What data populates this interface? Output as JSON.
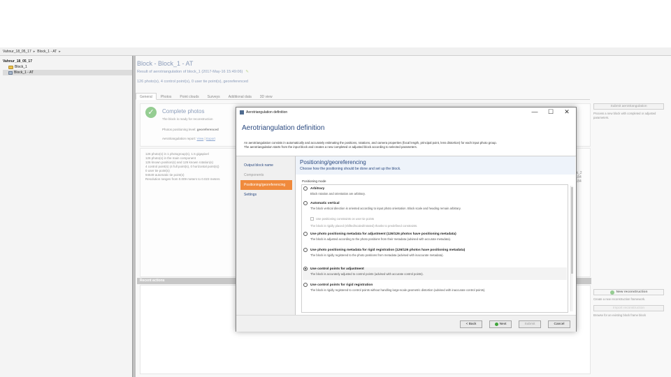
{
  "breadcrumb": {
    "items": [
      "Vahnur_18_05_17",
      "Block_1 - AT"
    ],
    "separator": "▸"
  },
  "tree": {
    "root": "Vahnur_18_05_17",
    "items": [
      "Block_1",
      "Block_1 - AT"
    ]
  },
  "block": {
    "title": "Block - Block_1 - AT",
    "result_line": "Result of aerotriangulation of block_1 (2017-May-16 15:49:06)",
    "counts_line": "126 photo(s), 4 control point(s), 0 user tie point(s), georeferenced"
  },
  "tabs": [
    "General",
    "Photos",
    "Point clouds",
    "Surveys",
    "Additional data",
    "3D view"
  ],
  "general": {
    "complete_title": "Complete photos",
    "complete_sub": "The block is ready for reconstruction",
    "pos_level_label": "Photos positioning level:",
    "pos_level_value": "georeferenced",
    "aero_report_label": "Aerotriangulation report:",
    "aero_report_link1": "View",
    "aero_report_sep": "|",
    "aero_report_link2": "Export"
  },
  "stats": [
    "126 photo(s) in 1 photogroup(s), 1.5 gigapixel",
    "126 photo(s) in the main component",
    "126 known position(s) and 126 known rotation(s)",
    "4 control point(s) (4 full point(s), 0 horizontal point(s))",
    "0 user tie point(s)",
    "94649 automatic tie point(s)",
    "Resolution ranges from 0.009 meters to 0.023 meters"
  ],
  "right_partial": [
    "ck_2",
    "8.84",
    "9.84"
  ],
  "side_panel": {
    "submit_aero_label": "Submit aerotriangulation",
    "submit_aero_desc": "Process a new block with completed or adjusted parameters.",
    "new_recon_label": "New reconstruction",
    "new_recon_desc": "Create a new reconstruction framework.",
    "import_recon_label": "Import reconstruction",
    "import_recon_desc": "Browse for an existing block frame block"
  },
  "recent": {
    "title": "Recent actions"
  },
  "dialog": {
    "window_title": "Aerotriangulation definition",
    "controls": {
      "minimize": "—",
      "maximize": "☐",
      "close": "✕"
    },
    "heading": "Aerotriangulation definition",
    "desc1": "An aerotriangulation consists in automatically and accurately estimating the positions, rotations, and camera properties (focal length, principal point, lens distortion) for each input photo group.",
    "desc2": "The aerotriangulation starts from the input block and creates a new completed or adjusted block according to selected parameters.",
    "nav": [
      "Output block name",
      "Components",
      "Positioning/georeferencing",
      "Settings"
    ],
    "content_title": "Positioning/georeferencing",
    "content_sub": "Choose how the positioning should be done and set up the block.",
    "mode_label": "Positioning mode",
    "options": [
      {
        "label": "Arbitrary",
        "desc": "Block rotation and orientation are arbitrary."
      },
      {
        "label": "Automatic vertical",
        "desc": "The block vertical direction is oriented according to input photo orientation. Block scale and heading remain arbitrary."
      },
      {
        "label": "Use photo positioning metadata for adjustment (126/126 photos have positioning metadata)",
        "desc": "The block is adjusted according to the photo positions from their metadata (advised with accurate metadata)."
      },
      {
        "label": "Use photo positioning metadata for rigid registration (126/126 photos have positioning metadata)",
        "desc": "The block is rigidly registered to the photo positions from metadata (advised with inaccurate metadata)."
      },
      {
        "label": "Use control points for adjustment",
        "desc": "The block is accurately adjusted to control points (advised with accurate control points)."
      },
      {
        "label": "Use control points for rigid registration",
        "desc": "The block is rigidly registered to control points without handling large-scale geometric distortion (advised with inaccurate control points)."
      }
    ],
    "suboptions": [
      "Use positioning constraints on user tie points",
      "The block is rigidly placed (shifted/scaled/rotated) thanks to predefined constraints."
    ],
    "selected_option": 4,
    "buttons": {
      "back": "< Back",
      "next": "Next",
      "submit": "Submit",
      "cancel": "Cancel"
    }
  },
  "colors": {
    "accent": "#2b4a80",
    "nav_active": "#f08a3c",
    "ok_green": "#3fa43a"
  }
}
